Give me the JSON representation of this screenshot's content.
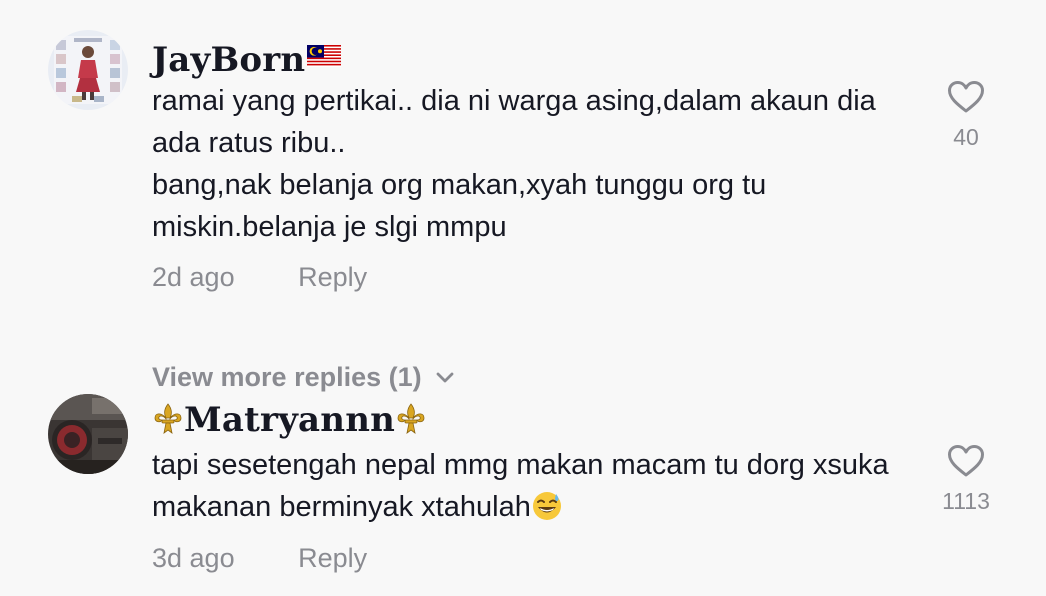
{
  "comments": [
    {
      "username": "JayBorn",
      "username_suffix_icon": "malaysia-flag-icon",
      "text": "ramai yang pertikai.. dia ni warga asing,dalam akaun dia ada ratus ribu..\nbang,nak belanja org makan,xyah tunggu org tu miskin.belanja je slgi mmpu",
      "time": "2d ago",
      "reply_label": "Reply",
      "likes": "40",
      "like_icon": "heart-outline-icon"
    },
    {
      "username": "Matryannn",
      "username_decoration_icon": "fleur-de-lis-icon",
      "text": "tapi sesetengah nepal mmg makan macam tu dorg xsuka makanan berminyak xtahulah",
      "text_suffix_icon": "grinning-sweat-emoji-icon",
      "time": "3d ago",
      "reply_label": "Reply",
      "likes": "1113",
      "like_icon": "heart-outline-icon"
    }
  ],
  "view_more_replies": {
    "label": "View more replies (1)",
    "icon": "chevron-down-icon"
  },
  "colors": {
    "background": "#f8f8f8",
    "primary_text": "#161823",
    "secondary_text": "#8a8b91"
  }
}
